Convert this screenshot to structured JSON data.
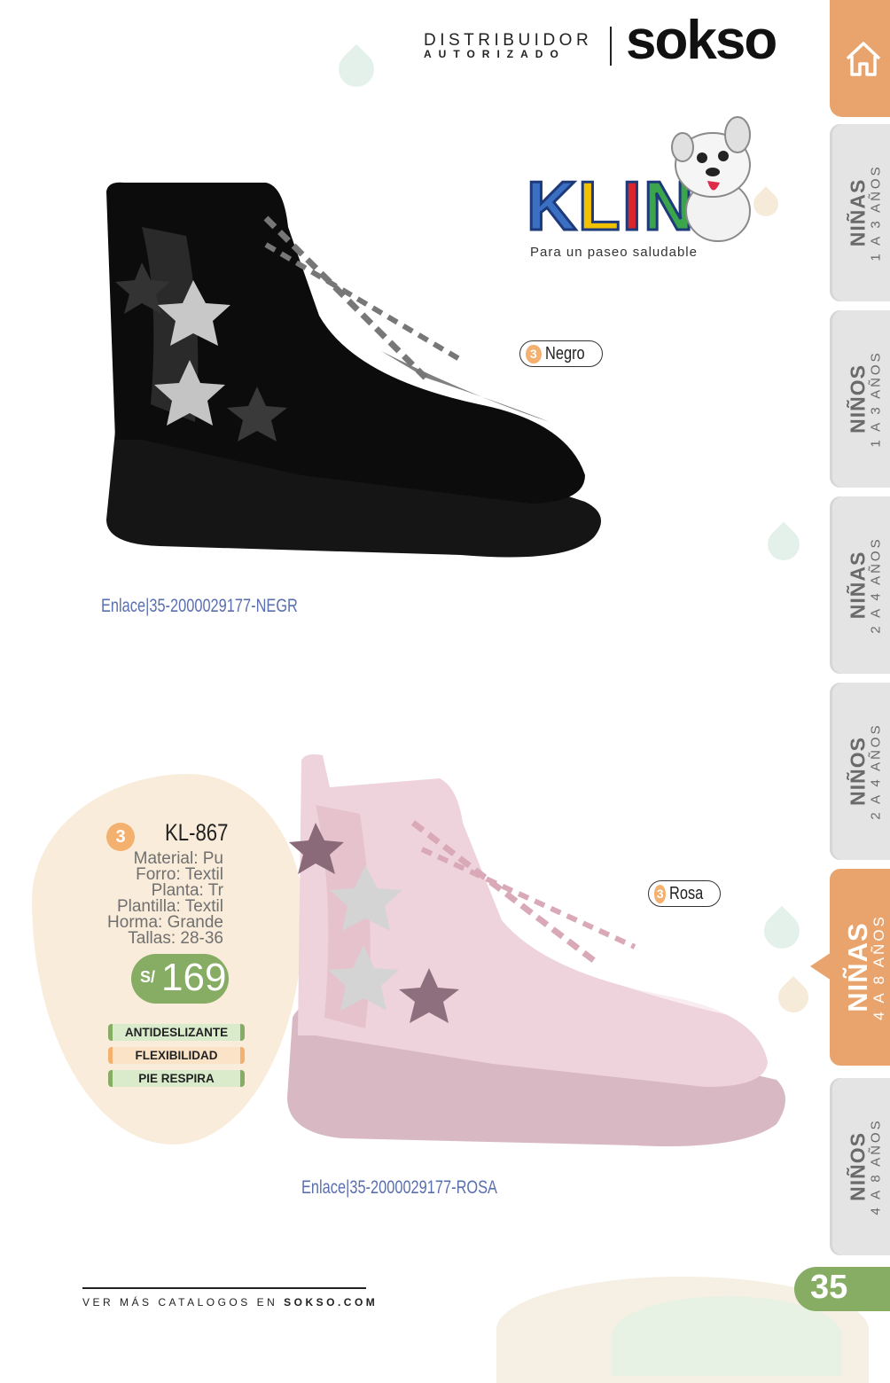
{
  "header": {
    "distributor_line1": "DISTRIBUIDOR",
    "distributor_line2": "AUTORIZADO",
    "brand": "sokso"
  },
  "klin_logo": {
    "letters": [
      "K",
      "L",
      "I",
      "N"
    ],
    "tagline": "Para un paseo saludable"
  },
  "products": [
    {
      "color_count": "3",
      "color_name": "Negro",
      "link": "Enlace|35-2000029177-NEGR"
    },
    {
      "color_count": "3",
      "color_name": "Rosa",
      "link": "Enlace|35-2000029177-ROSA"
    }
  ],
  "info": {
    "count": "3",
    "code": "KL-867",
    "specs": [
      "Material: Pu",
      "Forro: Textil",
      "Planta: Tr",
      "Plantilla: Textil",
      "Horma: Grande",
      "Tallas: 28-36"
    ],
    "price_currency": "S/",
    "price_value": "169",
    "badges": [
      "ANTIDESLIZANTE",
      "FLEXIBILIDAD",
      "PIE RESPIRA"
    ]
  },
  "side_tabs": [
    {
      "title": "NIÑAS",
      "subtitle": "1 A 3 AÑOS"
    },
    {
      "title": "NIÑOS",
      "subtitle": "1 A 3 AÑOS"
    },
    {
      "title": "NIÑAS",
      "subtitle": "2 A 4 AÑOS"
    },
    {
      "title": "NIÑOS",
      "subtitle": "2 A 4 AÑOS"
    },
    {
      "title": "NIÑAS",
      "subtitle": "4 A 8 AÑOS"
    },
    {
      "title": "NIÑOS",
      "subtitle": "4 A 8 AÑOS"
    }
  ],
  "footer": {
    "text": "VER MÁS CATALOGOS EN",
    "site": "SOKSO.COM",
    "page_number": "35"
  },
  "colors": {
    "accent_orange": "#e8a46c",
    "accent_green": "#86ad63",
    "tab_gray": "#e4e4e4",
    "link_blue": "#5a6fae",
    "blob_cream": "#f9ecda"
  },
  "icons": {
    "home": "home-icon"
  }
}
